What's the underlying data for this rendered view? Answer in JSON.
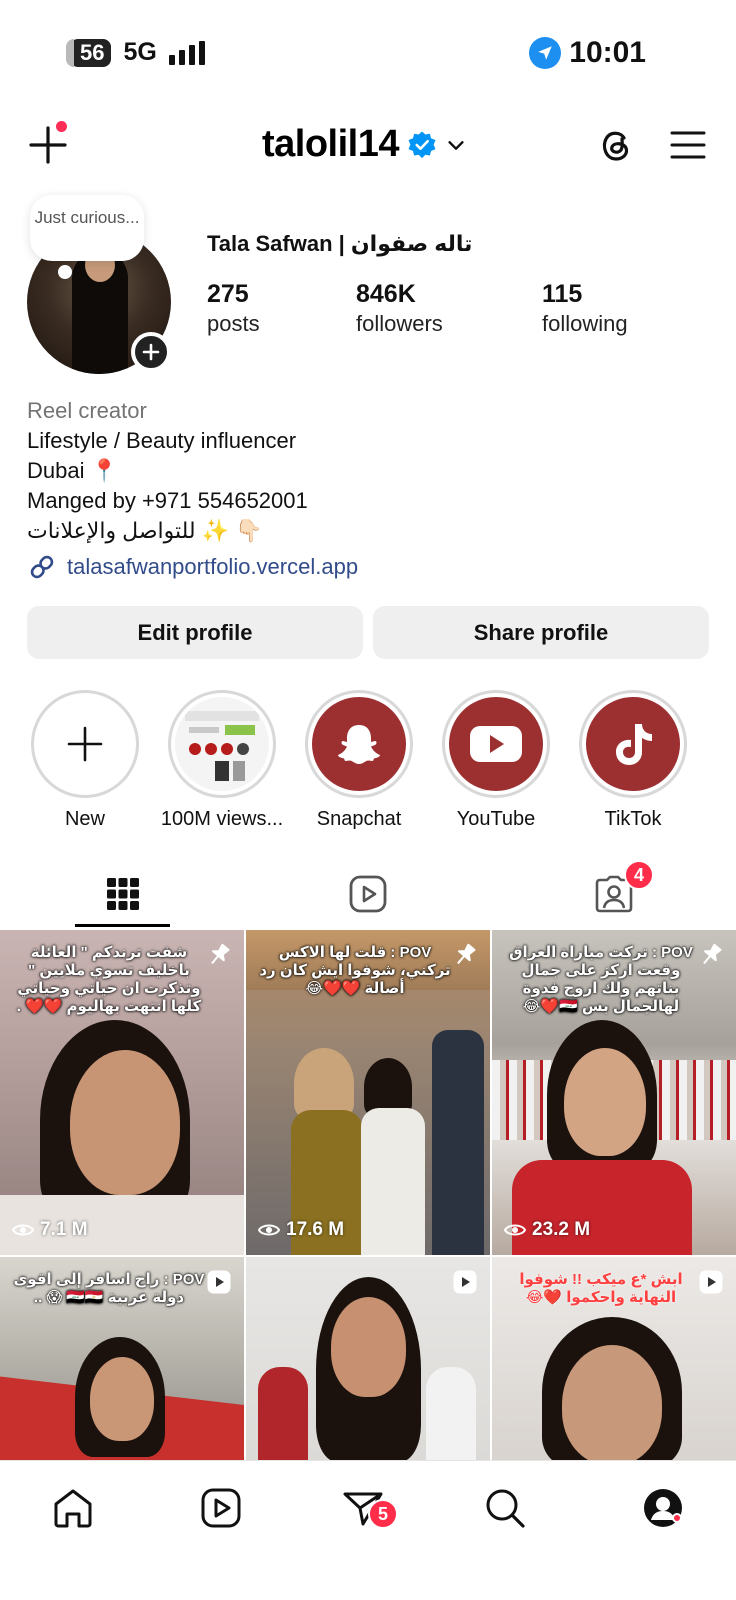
{
  "status_bar": {
    "battery": "56",
    "network": "5G",
    "time": "10:01"
  },
  "header": {
    "username": "talolil14",
    "verified": true
  },
  "profile": {
    "note": "Just curious...",
    "display_name": "Tala Safwan | تاله صفوان",
    "stats": [
      {
        "value": "275",
        "label": "posts"
      },
      {
        "value": "846K",
        "label": "followers"
      },
      {
        "value": "115",
        "label": "following"
      }
    ],
    "bio": {
      "category": "Reel creator",
      "lines": [
        "Lifestyle / Beauty influencer",
        "Dubai 📍",
        "Manged by +971 554652001",
        "للتواصل والإعلانات ✨ 👇🏻"
      ],
      "link": "talasafwanportfolio.vercel.app"
    },
    "buttons": {
      "edit": "Edit profile",
      "share": "Share profile"
    }
  },
  "highlights": [
    {
      "label": "New",
      "icon": "plus-icon"
    },
    {
      "label": "100M views...",
      "icon": "collage-thumbnail"
    },
    {
      "label": "Snapchat",
      "icon": "snapchat-icon"
    },
    {
      "label": "YouTube",
      "icon": "youtube-icon"
    },
    {
      "label": "TikTok",
      "icon": "tiktok-icon"
    }
  ],
  "tabs": {
    "tagged_badge": "4"
  },
  "posts": [
    {
      "caption": "شفت ترندكم \" العائلة باخليف تسوي ملايين \" وتذكرت ان حياتي وحياتي كلها انتهت بهاليوم ❤️❤️ .",
      "views": "7.1 M",
      "type": "pinned"
    },
    {
      "caption": "POV : قلت لها الاكس تركني، شوفوا ايش كان رد أصالة ❤️❤️😂",
      "views": "17.6 M",
      "type": "pinned"
    },
    {
      "caption": "POV : تركت مباراة العراق وقعت اركز على جمال بناتهم ولك اروح فدوة لهالجمال بس 🇮🇶❤️😂",
      "views": "23.2 M",
      "type": "pinned"
    },
    {
      "caption": "POV : راح اسافر إلى اقوى دولة عربية 🇮🇶🇪🇬 😱 ..",
      "views": "",
      "type": "reel"
    },
    {
      "caption": "",
      "views": "",
      "type": "reel"
    },
    {
      "caption": "ابش *ع ميكب !! شوفوا النهاية واحكموا ❤️😂",
      "views": "",
      "type": "reel"
    }
  ],
  "bottom_nav": {
    "messages_badge": "5"
  },
  "colors": {
    "verified": "#0095f6",
    "badge": "#ff2d4a",
    "link": "#324b8a",
    "highlight": "#9c2f30"
  }
}
